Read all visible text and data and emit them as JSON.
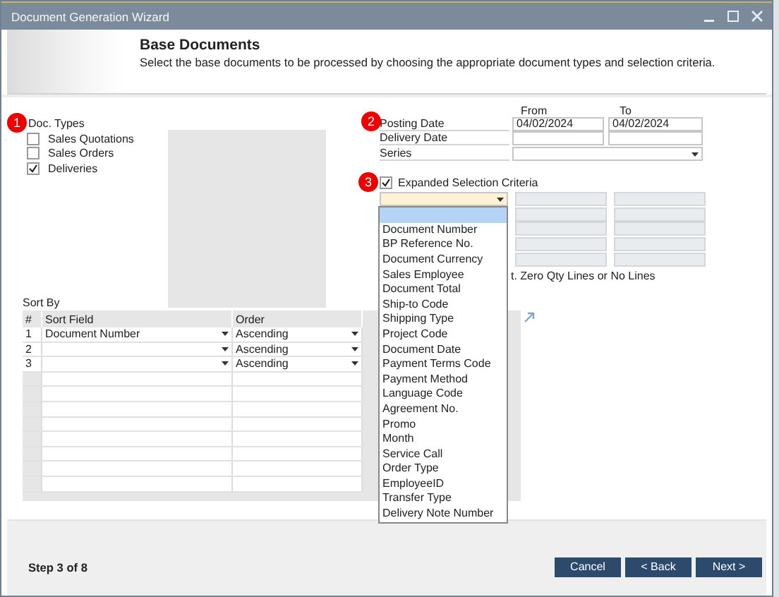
{
  "window": {
    "title": "Document Generation Wizard"
  },
  "header": {
    "title": "Base Documents",
    "description": "Select the base documents to be processed by choosing the appropriate document types and selection criteria."
  },
  "doc_types": {
    "badge": "1",
    "label": "Doc. Types",
    "items": [
      {
        "label": "Sales Quotations",
        "checked": false
      },
      {
        "label": "Sales Orders",
        "checked": false
      },
      {
        "label": "Deliveries",
        "checked": true
      }
    ]
  },
  "dates": {
    "badge": "2",
    "from_label": "From",
    "to_label": "To",
    "rows": [
      {
        "kind": "range",
        "label": "Posting Date",
        "from": "04/02/2024",
        "to": "04/02/2024"
      },
      {
        "kind": "range",
        "label": "Delivery Date"
      },
      {
        "kind": "dropdown",
        "label": "Series"
      }
    ]
  },
  "expanded": {
    "badge": "3",
    "label": "Expanded Selection Criteria",
    "checked": true,
    "note": "t. Zero Qty Lines or No Lines",
    "options": [
      {
        "selected": true
      },
      {
        "label": "Document Number",
        "selected": false
      },
      {
        "label": "BP Reference No.",
        "selected": false
      },
      {
        "label": "Document Currency",
        "selected": false
      },
      {
        "label": "Sales Employee",
        "selected": false
      },
      {
        "label": "Document Total",
        "selected": false
      },
      {
        "label": "Ship-to Code",
        "selected": false
      },
      {
        "label": "Shipping Type",
        "selected": false
      },
      {
        "label": "Project Code",
        "selected": false
      },
      {
        "label": "Document Date",
        "selected": false
      },
      {
        "label": "Payment Terms Code",
        "selected": false
      },
      {
        "label": "Payment Method",
        "selected": false
      },
      {
        "label": "Language Code",
        "selected": false
      },
      {
        "label": "Agreement No.",
        "selected": false
      },
      {
        "label": "Promo",
        "selected": false
      },
      {
        "label": "Month",
        "selected": false
      },
      {
        "label": "Service Call",
        "selected": false
      },
      {
        "label": "Order Type",
        "selected": false
      },
      {
        "label": "EmployeeID",
        "selected": false
      },
      {
        "label": "Transfer Type",
        "selected": false
      },
      {
        "label": "Delivery Note Number",
        "selected": false
      }
    ]
  },
  "sort_by": {
    "label": "Sort By",
    "columns": [
      "#",
      "Sort Field",
      "Order"
    ],
    "rows": [
      {
        "number": "1",
        "sort_field": "Document Number",
        "order": "Ascending"
      },
      {
        "number": "2",
        "order": "Ascending"
      },
      {
        "number": "3",
        "order": "Ascending"
      }
    ]
  },
  "footer": {
    "step": "Step 3 of 8",
    "buttons": [
      "Cancel",
      "< Back",
      "Next >"
    ]
  }
}
